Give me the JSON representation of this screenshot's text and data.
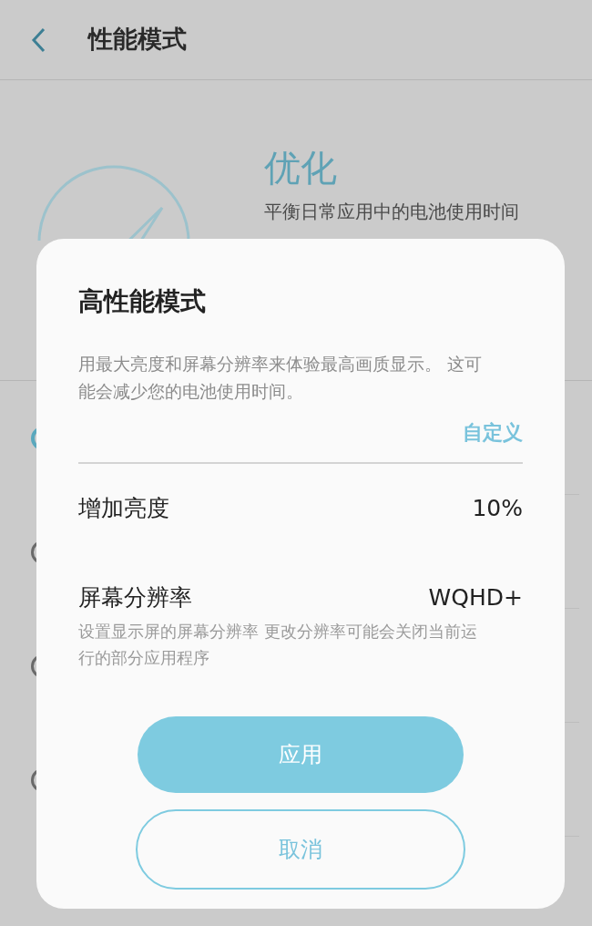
{
  "header": {
    "title": "性能模式"
  },
  "mode": {
    "title": "优化",
    "description_lines": [
      "平衡日常应用中的电池使用时间"
    ]
  },
  "options": [
    {
      "selected": true
    },
    {
      "selected": false
    },
    {
      "selected": false
    },
    {
      "selected": false
    }
  ],
  "dialog": {
    "title": "高性能模式",
    "description": "用最大亮度和屏幕分辨率来体验最高画质显示。 这可能会减少您的电池使用时间。",
    "customize_link": "自定义",
    "settings": [
      {
        "label": "增加亮度",
        "value": "10%"
      },
      {
        "label": "屏幕分辨率",
        "value": "WQHD+",
        "description": "设置显示屏的屏幕分辨率 更改分辨率可能会关闭当前运行的部分应用程序"
      }
    ],
    "buttons": [
      {
        "label": "应用",
        "kind": "primary"
      },
      {
        "label": "取消",
        "kind": "secondary"
      }
    ]
  }
}
